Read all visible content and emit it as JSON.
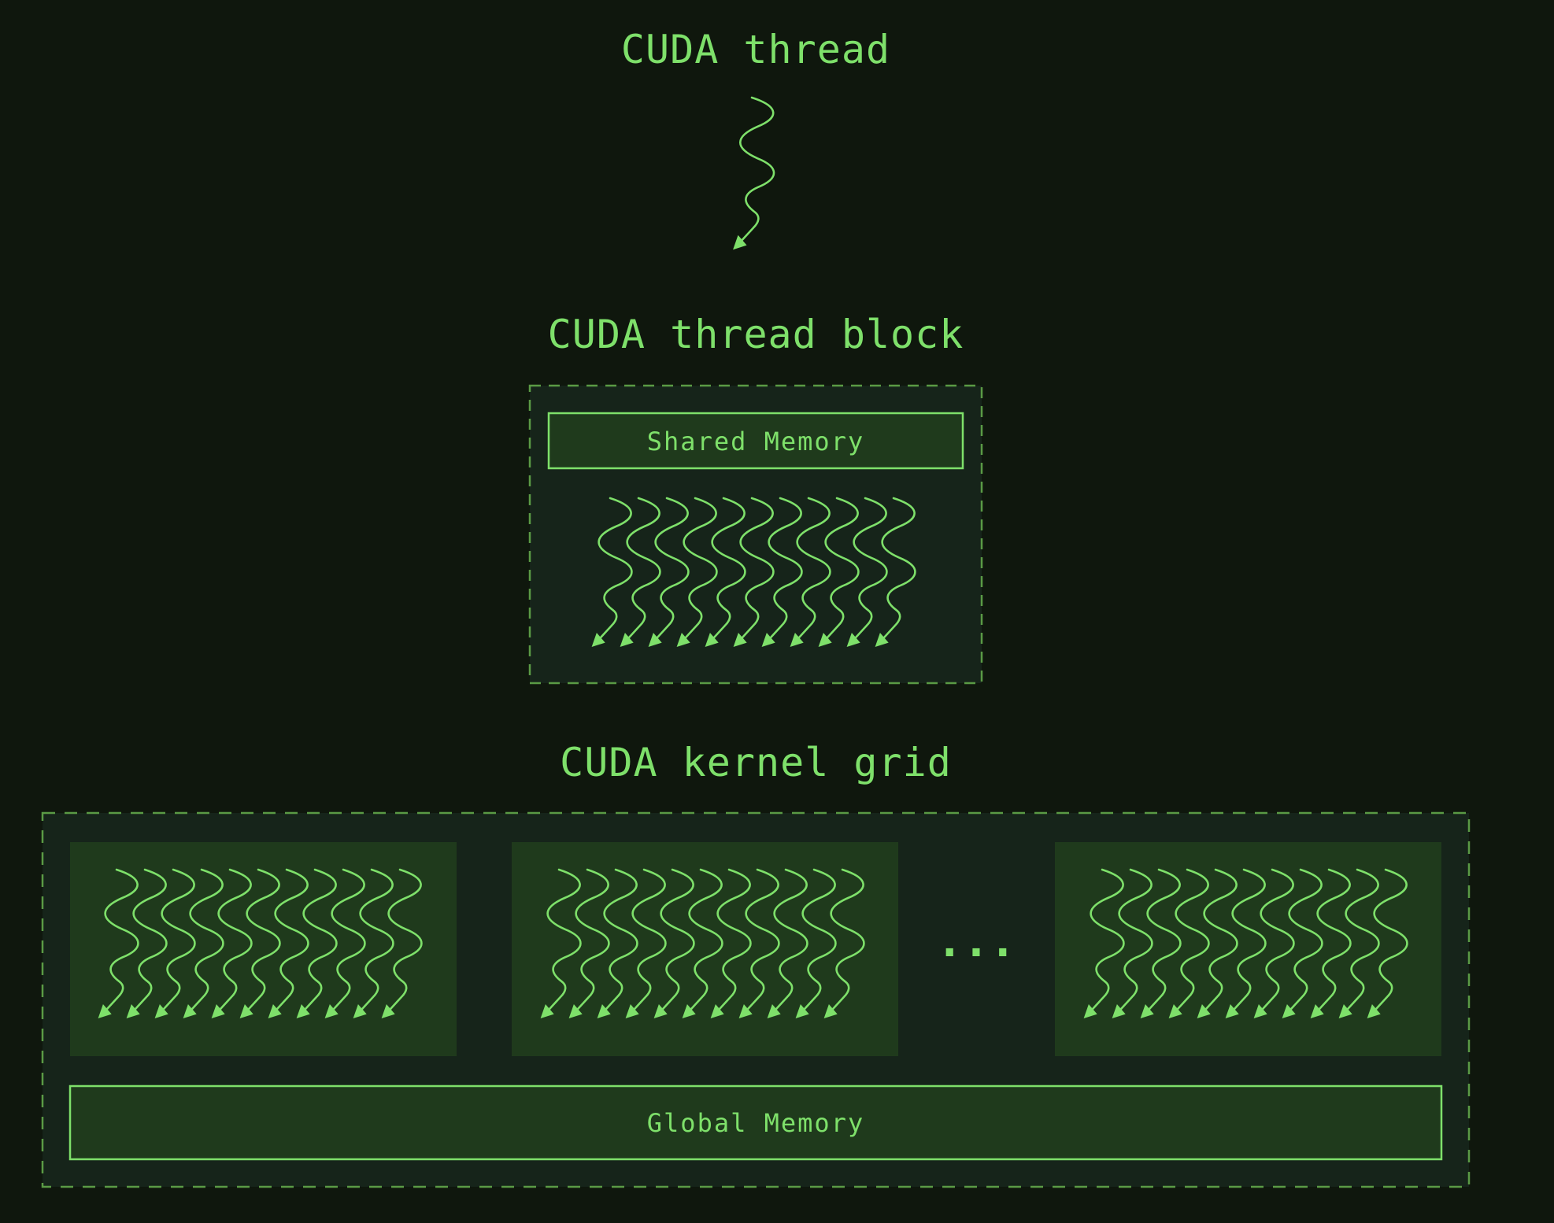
{
  "titles": {
    "thread": "CUDA thread",
    "block": "CUDA thread block",
    "grid": "CUDA kernel grid"
  },
  "labels": {
    "shared_memory": "Shared Memory",
    "global_memory": "Global Memory",
    "ellipsis": "..."
  },
  "counts": {
    "threads_per_block": 11,
    "blocks_shown": 3
  },
  "colors": {
    "background": "#0f170d",
    "accent": "#7ee06a",
    "panel": "#16241a",
    "block_fill": "#1f3a1c",
    "dashed_border": "#5a9a45"
  }
}
